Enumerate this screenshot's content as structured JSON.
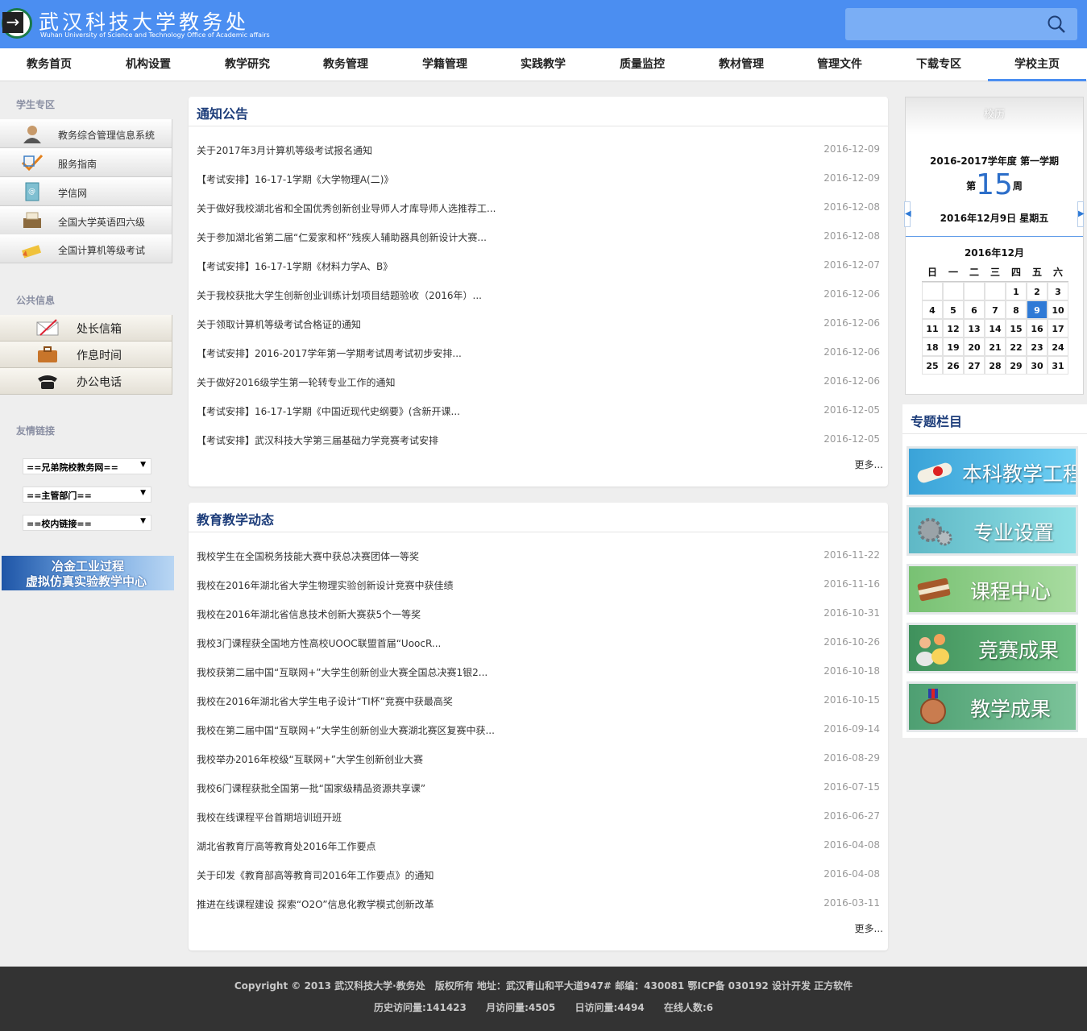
{
  "header": {
    "title": "武汉科技大学教务处",
    "subtitle": "Wuhan University of Science and Technology Office of Academic affairs",
    "search_placeholder": ""
  },
  "nav": [
    "教务首页",
    "机构设置",
    "教学研究",
    "教务管理",
    "学籍管理",
    "实践教学",
    "质量监控",
    "教材管理",
    "管理文件",
    "下载专区",
    "学校主页"
  ],
  "nav_active": "学校主页",
  "sidebar": {
    "student_title": "学生专区",
    "student_items": [
      {
        "label": "教务综合管理信息系统",
        "icon": "user-icon"
      },
      {
        "label": "服务指南",
        "icon": "checklist-icon"
      },
      {
        "label": "学信网",
        "icon": "book-icon"
      },
      {
        "label": "全国大学英语四六级",
        "icon": "printer-icon"
      },
      {
        "label": "全国计算机等级考试",
        "icon": "pencil-icon"
      }
    ],
    "public_title": "公共信息",
    "public_items": [
      {
        "label": "处长信箱",
        "icon": "envelope-icon"
      },
      {
        "label": "作息时间",
        "icon": "briefcase-icon"
      },
      {
        "label": "办公电话",
        "icon": "phone-icon"
      }
    ],
    "links_title": "友情链接",
    "selects": [
      "==兄弟院校教务网==",
      "==主管部门==",
      "==校内链接=="
    ],
    "banner_line1": "冶金工业过程",
    "banner_line2": "虚拟仿真实验教学中心"
  },
  "notices": {
    "title": "通知公告",
    "more": "更多...",
    "items": [
      {
        "title": "关于2017年3月计算机等级考试报名通知",
        "date": "2016-12-09"
      },
      {
        "title": "【考试安排】16-17-1学期《大学物理A(二)》",
        "date": "2016-12-09"
      },
      {
        "title": "关于做好我校湖北省和全国优秀创新创业导师人才库导师人选推荐工...",
        "date": "2016-12-08"
      },
      {
        "title": "关于参加湖北省第二届“仁爱家和杯”残疾人辅助器具创新设计大赛...",
        "date": "2016-12-08"
      },
      {
        "title": "【考试安排】16-17-1学期《材料力学A、B》",
        "date": "2016-12-07"
      },
      {
        "title": "关于我校获批大学生创新创业训练计划项目结题验收（2016年）...",
        "date": "2016-12-06"
      },
      {
        "title": "关于领取计算机等级考试合格证的通知",
        "date": "2016-12-06"
      },
      {
        "title": "【考试安排】2016-2017学年第一学期考试周考试初步安排...",
        "date": "2016-12-06"
      },
      {
        "title": "关于做好2016级学生第一轮转专业工作的通知",
        "date": "2016-12-06"
      },
      {
        "title": "【考试安排】16-17-1学期《中国近现代史纲要》(含新开课...",
        "date": "2016-12-05"
      },
      {
        "title": "【考试安排】武汉科技大学第三届基础力学竞赛考试安排",
        "date": "2016-12-05"
      }
    ]
  },
  "news": {
    "title": "教育教学动态",
    "more": "更多...",
    "items": [
      {
        "title": "我校学生在全国税务技能大赛中获总决赛团体一等奖",
        "date": "2016-11-22"
      },
      {
        "title": "我校在2016年湖北省大学生物理实验创新设计竞赛中获佳绩",
        "date": "2016-11-16"
      },
      {
        "title": "我校在2016年湖北省信息技术创新大赛获5个一等奖",
        "date": "2016-10-31"
      },
      {
        "title": "我校3门课程获全国地方性高校UOOC联盟首届“UoocR...",
        "date": "2016-10-26"
      },
      {
        "title": "我校获第二届中国“互联网+”大学生创新创业大赛全国总决赛1银2...",
        "date": "2016-10-18"
      },
      {
        "title": "我校在2016年湖北省大学生电子设计“TI杯”竞赛中获最高奖",
        "date": "2016-10-15"
      },
      {
        "title": "我校在第二届中国“互联网+”大学生创新创业大赛湖北赛区复赛中获...",
        "date": "2016-09-14"
      },
      {
        "title": "我校举办2016年校级“互联网+”大学生创新创业大赛",
        "date": "2016-08-29"
      },
      {
        "title": "我校6门课程获批全国第一批“国家级精品资源共享课”",
        "date": "2016-07-15"
      },
      {
        "title": "我校在线课程平台首期培训班开班",
        "date": "2016-06-27"
      },
      {
        "title": "湖北省教育厅高等教育处2016年工作要点",
        "date": "2016-04-08"
      },
      {
        "title": "关于印发《教育部高等教育司2016年工作要点》的通知",
        "date": "2016-04-08"
      },
      {
        "title": "推进在线课程建设 探索“O2O”信息化教学模式创新改革",
        "date": "2016-03-11"
      }
    ]
  },
  "calendar": {
    "title": "校历",
    "semester": "2016-2017学年度 第一学期",
    "week_prefix": "第",
    "week_number": "15",
    "week_suffix": "周",
    "today": "2016年12月9日 星期五",
    "month": "2016年12月",
    "weekdays": [
      "日",
      "一",
      "二",
      "三",
      "四",
      "五",
      "六"
    ],
    "weeks": [
      [
        "",
        "",
        "",
        "",
        "1",
        "2",
        "3"
      ],
      [
        "4",
        "5",
        "6",
        "7",
        "8",
        "9",
        "10"
      ],
      [
        "11",
        "12",
        "13",
        "14",
        "15",
        "16",
        "17"
      ],
      [
        "18",
        "19",
        "20",
        "21",
        "22",
        "23",
        "24"
      ],
      [
        "25",
        "26",
        "27",
        "28",
        "29",
        "30",
        "31"
      ]
    ],
    "selected_day": "9",
    "prev": "◀",
    "next": "▶"
  },
  "topics": {
    "title": "专题栏目",
    "items": [
      {
        "label": "本科教学工程",
        "color": "#2aa7de"
      },
      {
        "label": "专业设置",
        "color": "#6cc7d3"
      },
      {
        "label": "课程中心",
        "color": "#7bc47a"
      },
      {
        "label": "竞赛成果",
        "color": "#4aa067"
      },
      {
        "label": "教学成果",
        "color": "#58aa7f"
      }
    ]
  },
  "footer": {
    "line1": "Copyright © 2013 武汉科技大学·教务处　版权所有  地址：武汉青山和平大道947#  邮编：430081 鄂ICP备 030192  设计开发 正方软件",
    "stats": [
      "历史访问量:141423",
      "月访问量:4505",
      "日访问量:4494",
      "在线人数:6"
    ]
  },
  "colors": {
    "header_blue": "#4b8ef1",
    "title_blue": "#1d3d7a",
    "footer": "#333333"
  }
}
